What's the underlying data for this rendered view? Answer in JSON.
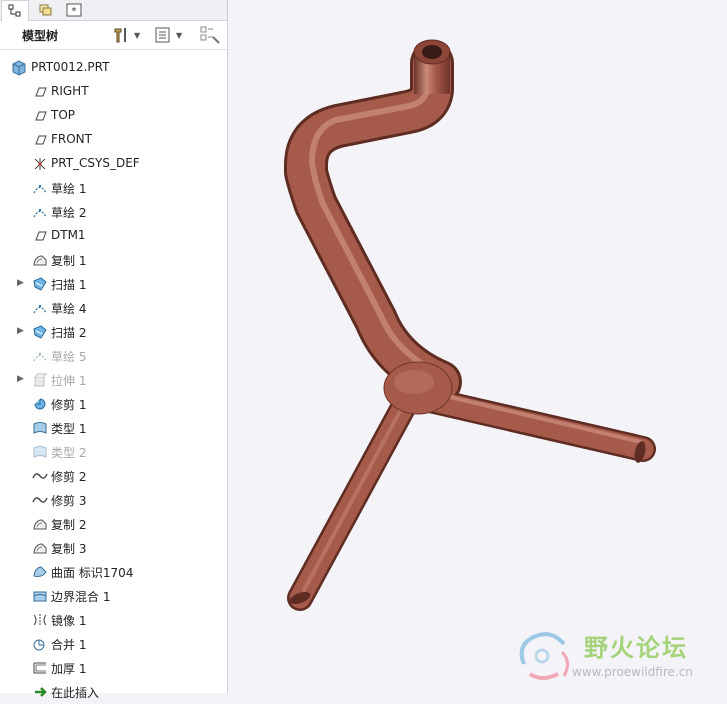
{
  "tabs": [
    {
      "name": "model-tree-tab-icon",
      "active": true
    },
    {
      "name": "layers-tab-icon",
      "active": false
    },
    {
      "name": "favorites-tab-icon",
      "active": false
    }
  ],
  "model_tree": {
    "title": "模型树",
    "settings_icon": "tools-icon",
    "show_icon": "list-icon",
    "filter_icon": "filter-icon"
  },
  "tree_items": [
    {
      "label": "PRT0012.PRT",
      "icon": "part-icon",
      "indent": 0,
      "expandable": false,
      "dim": false
    },
    {
      "label": "RIGHT",
      "icon": "datum-plane-icon",
      "indent": 1,
      "expandable": false,
      "dim": false
    },
    {
      "label": "TOP",
      "icon": "datum-plane-icon",
      "indent": 1,
      "expandable": false,
      "dim": false
    },
    {
      "label": "FRONT",
      "icon": "datum-plane-icon",
      "indent": 1,
      "expandable": false,
      "dim": false
    },
    {
      "label": "PRT_CSYS_DEF",
      "icon": "csys-icon",
      "indent": 1,
      "expandable": false,
      "dim": false
    },
    {
      "label": "草绘 1",
      "icon": "sketch-icon",
      "indent": 1,
      "expandable": false,
      "dim": false
    },
    {
      "label": "草绘 2",
      "icon": "sketch-icon",
      "indent": 1,
      "expandable": false,
      "dim": false
    },
    {
      "label": "DTM1",
      "icon": "datum-plane-icon",
      "indent": 1,
      "expandable": false,
      "dim": false
    },
    {
      "label": "复制 1",
      "icon": "copy-icon",
      "indent": 1,
      "expandable": false,
      "dim": false
    },
    {
      "label": "扫描 1",
      "icon": "sweep-icon",
      "indent": 1,
      "expandable": true,
      "dim": false
    },
    {
      "label": "草绘 4",
      "icon": "sketch-icon",
      "indent": 1,
      "expandable": false,
      "dim": false
    },
    {
      "label": "扫描 2",
      "icon": "sweep-icon",
      "indent": 1,
      "expandable": true,
      "dim": false
    },
    {
      "label": "草绘 5",
      "icon": "sketch-icon",
      "indent": 1,
      "expandable": false,
      "dim": true
    },
    {
      "label": "拉伸 1",
      "icon": "extrude-icon",
      "indent": 1,
      "expandable": true,
      "dim": true
    },
    {
      "label": "修剪 1",
      "icon": "trim-icon",
      "indent": 1,
      "expandable": false,
      "dim": false
    },
    {
      "label": "类型 1",
      "icon": "surface-type-icon",
      "indent": 1,
      "expandable": false,
      "dim": false
    },
    {
      "label": "类型 2",
      "icon": "surface-type-icon",
      "indent": 1,
      "expandable": false,
      "dim": true
    },
    {
      "label": "修剪 2",
      "icon": "curve-trim-icon",
      "indent": 1,
      "expandable": false,
      "dim": false
    },
    {
      "label": "修剪 3",
      "icon": "curve-trim-icon",
      "indent": 1,
      "expandable": false,
      "dim": false
    },
    {
      "label": "复制 2",
      "icon": "copy-icon",
      "indent": 1,
      "expandable": false,
      "dim": false
    },
    {
      "label": "复制 3",
      "icon": "copy-icon",
      "indent": 1,
      "expandable": false,
      "dim": false
    },
    {
      "label": "曲面 标识1704",
      "icon": "surface-icon",
      "indent": 1,
      "expandable": false,
      "dim": false
    },
    {
      "label": "边界混合 1",
      "icon": "boundary-blend-icon",
      "indent": 1,
      "expandable": false,
      "dim": false
    },
    {
      "label": "镜像 1",
      "icon": "mirror-icon",
      "indent": 1,
      "expandable": false,
      "dim": false
    },
    {
      "label": "合并 1",
      "icon": "merge-icon",
      "indent": 1,
      "expandable": false,
      "dim": false
    },
    {
      "label": "加厚 1",
      "icon": "thicken-icon",
      "indent": 1,
      "expandable": false,
      "dim": false
    },
    {
      "label": "在此插入",
      "icon": "insert-here-icon",
      "indent": 1,
      "expandable": false,
      "dim": false
    }
  ],
  "watermark": {
    "logo_text": "野火论坛",
    "url": "www.proewildfire.cn"
  },
  "colors": {
    "pipe": "#a65a4a",
    "pipe_dark": "#6e342a",
    "pipe_light": "#c98a78",
    "background": "#f4f4f8",
    "watermark_green": "#a5d37a"
  }
}
